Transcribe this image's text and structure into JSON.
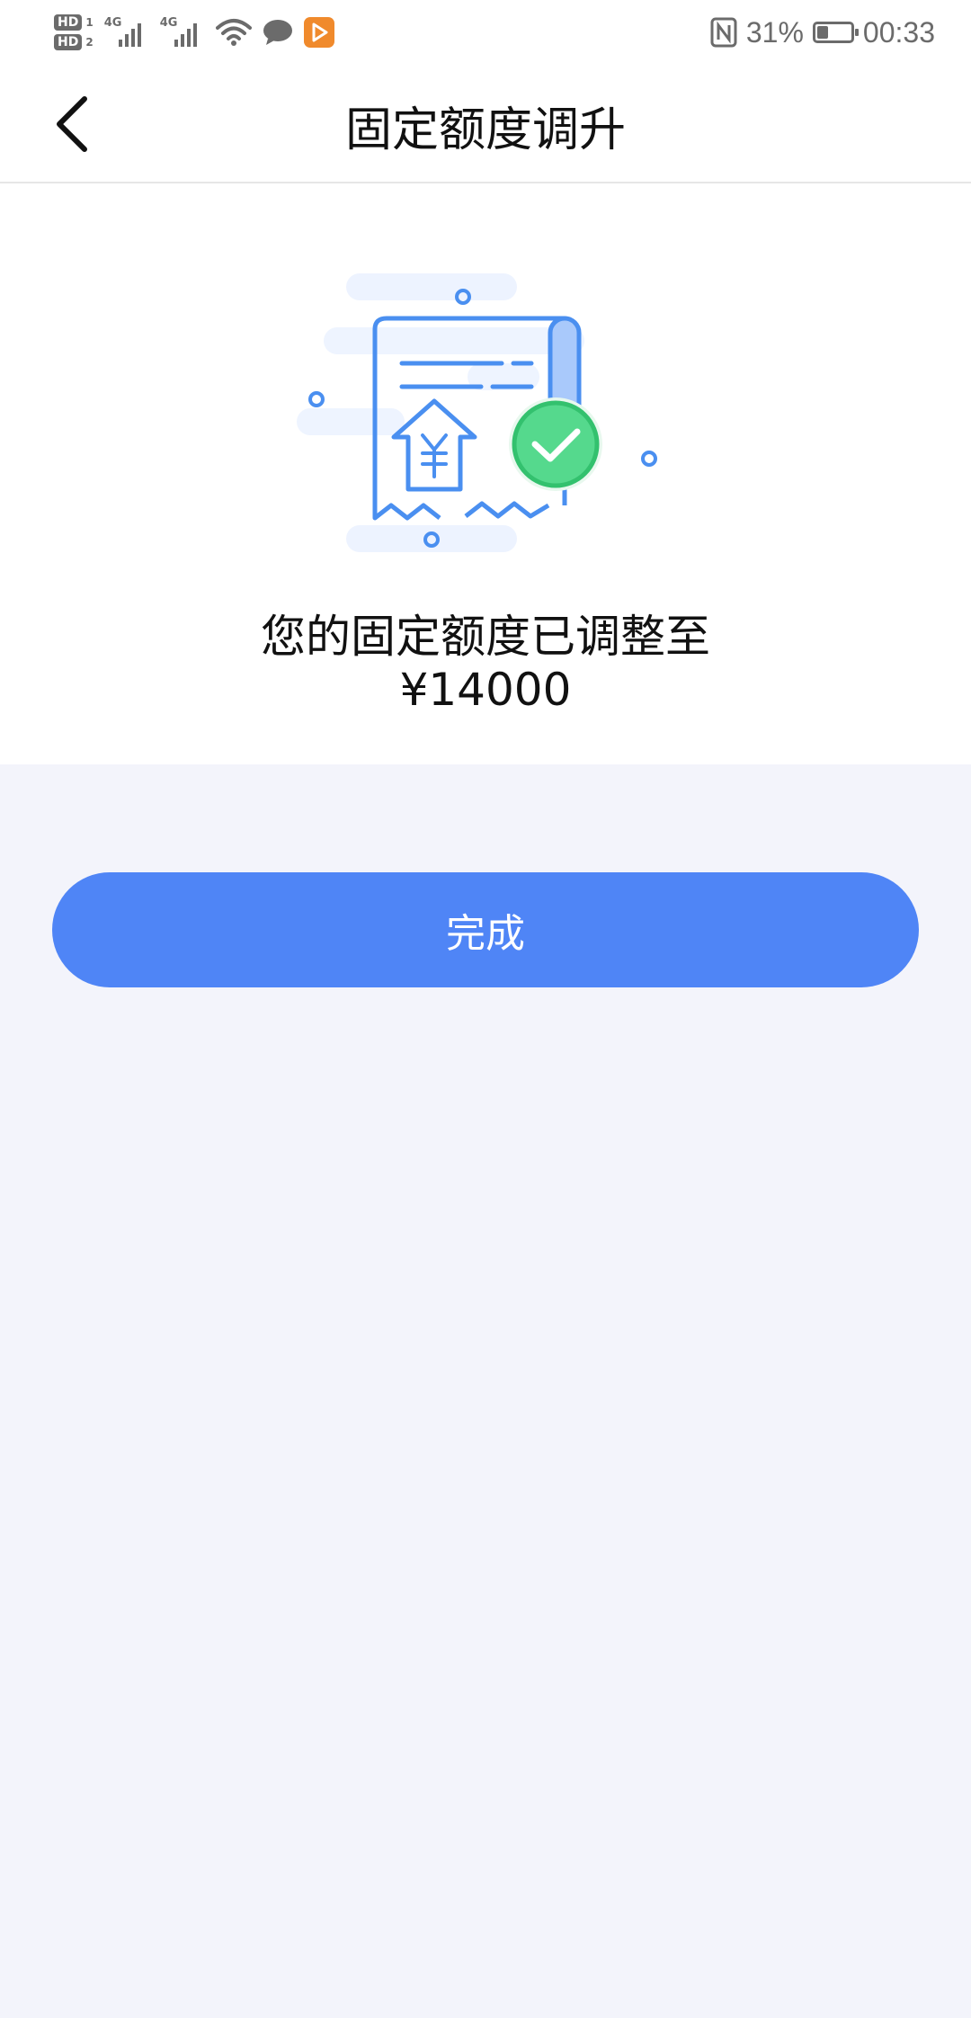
{
  "status_bar": {
    "hd1": "HD",
    "hd1_index": "1",
    "hd2": "HD",
    "hd2_index": "2",
    "network1": "4G",
    "network2": "4G",
    "battery_percent": "31%",
    "time": "00:33",
    "icons": [
      "hd-badge-icon",
      "signal-icon",
      "wifi-icon",
      "message-icon",
      "app-notification-icon",
      "nfc-icon",
      "battery-icon"
    ]
  },
  "header": {
    "title": "固定额度调升",
    "back_icon": "chevron-left-icon"
  },
  "result": {
    "illustration": "receipt-with-yuan-and-check-icon",
    "message": "您的固定额度已调整至",
    "amount": "¥14000"
  },
  "actions": {
    "done_label": "完成"
  },
  "colors": {
    "accent": "#4f85f6",
    "success": "#3ccf7a",
    "illustration_blue": "#4a8ff0",
    "page_background": "#f3f4fb"
  }
}
